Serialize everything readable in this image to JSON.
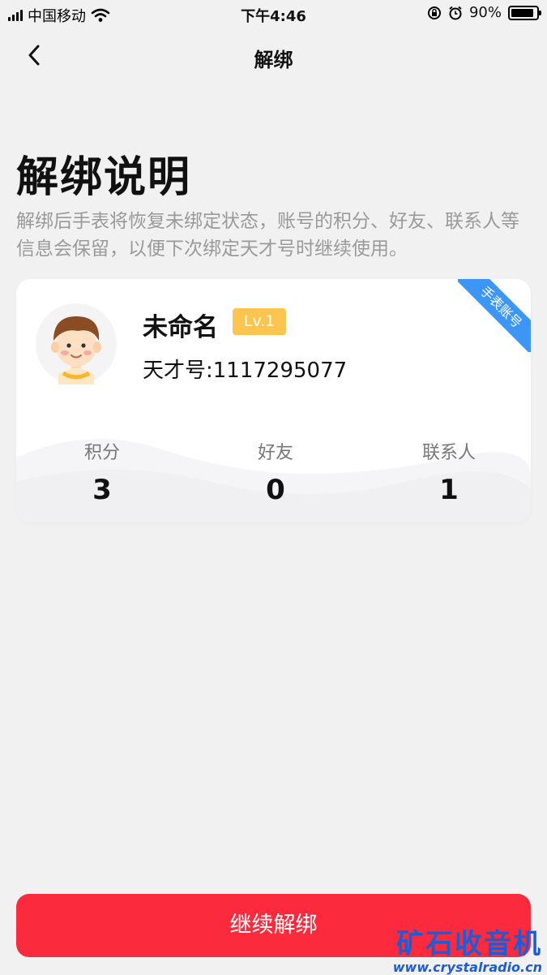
{
  "status_bar": {
    "carrier": "中国移动",
    "time": "下午4:46",
    "battery_percent_label": "90%",
    "battery_level": 0.9
  },
  "nav": {
    "title": "解绑"
  },
  "heading": "解绑说明",
  "description": "解绑后手表将恢复未绑定状态，账号的积分、好友、联系人等信息会保留，以便下次绑定天才号时继续使用。",
  "card": {
    "ribbon": "手表账号",
    "name": "未命名",
    "level": "Lv.1",
    "tiancai_id": "天才号:1117295077",
    "stats": [
      {
        "label": "积分",
        "value": "3"
      },
      {
        "label": "好友",
        "value": "0"
      },
      {
        "label": "联系人",
        "value": "1"
      }
    ]
  },
  "actions": {
    "continue_label": "继续解绑"
  },
  "watermark": {
    "title": "矿石收音机",
    "url": "www.crystalradio.cn"
  },
  "colors": {
    "accent": "#fb2a3c",
    "ribbon": "#3d96f5",
    "level_badge": "#fdc54f",
    "background": "#f1f1f1"
  }
}
